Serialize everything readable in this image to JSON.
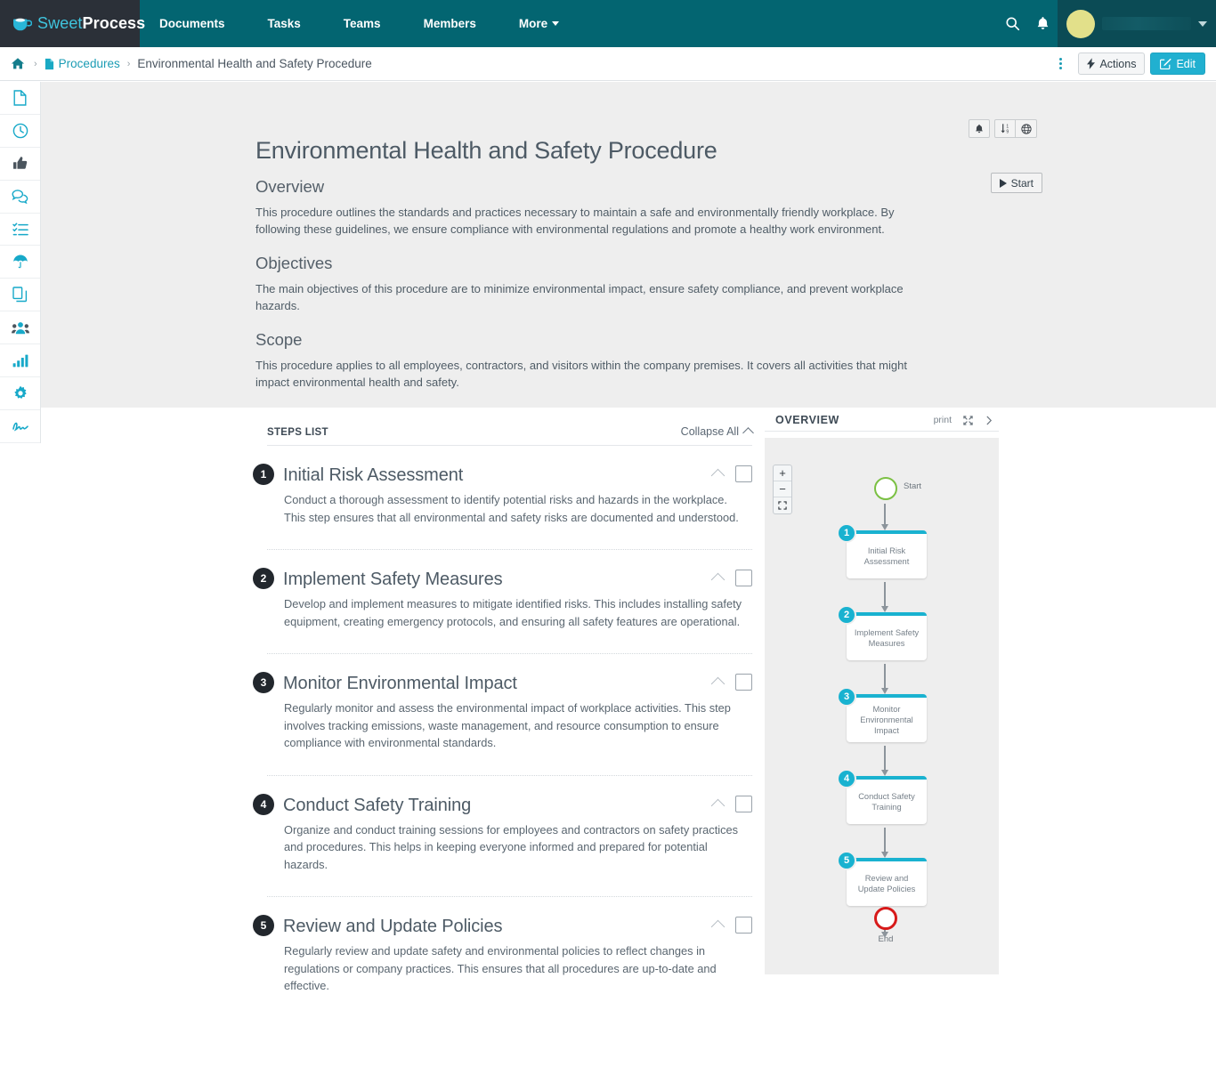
{
  "brand": {
    "name_light": "Sweet",
    "name_bold": "Process",
    "logo_icon": "coffee-cup-icon",
    "accent_cyan": "#19b2d0",
    "nav_teal": "#036571",
    "logo_dark": "#2b3038"
  },
  "topnav": {
    "items": [
      {
        "label": "Documents",
        "name": "nav-documents"
      },
      {
        "label": "Tasks",
        "name": "nav-tasks"
      },
      {
        "label": "Teams",
        "name": "nav-teams"
      },
      {
        "label": "Members",
        "name": "nav-members"
      },
      {
        "label": "More",
        "name": "nav-more",
        "has_caret": true
      }
    ],
    "search_icon": "search-icon",
    "bell_icon": "bell-icon",
    "avatar_color": "#e2e08a"
  },
  "breadcrumb": {
    "home_icon": "home-icon",
    "doc_icon": "document-icon",
    "separator": "›",
    "link": "Procedures",
    "current": "Environmental Health and Safety Procedure",
    "kebab_icon": "kebab-menu-icon",
    "actions_label": "Actions",
    "actions_icon": "lightning-bolt-icon",
    "edit_label": "Edit",
    "edit_icon": "pencil-square-icon"
  },
  "rail": {
    "items": [
      {
        "icon": "document-icon",
        "name": "rail-documents"
      },
      {
        "icon": "clock-icon",
        "name": "rail-recent"
      },
      {
        "icon": "thumbs-up-icon",
        "name": "rail-approvals"
      },
      {
        "icon": "chat-bubbles-icon",
        "name": "rail-comments"
      },
      {
        "icon": "checklist-icon",
        "name": "rail-tasks"
      },
      {
        "icon": "umbrella-icon",
        "name": "rail-policies"
      },
      {
        "icon": "copy-pages-icon",
        "name": "rail-duplicates"
      },
      {
        "icon": "users-group-icon",
        "name": "rail-teams"
      },
      {
        "icon": "bar-chart-icon",
        "name": "rail-reports"
      },
      {
        "icon": "gear-icon",
        "name": "rail-settings"
      },
      {
        "icon": "signature-icon",
        "name": "rail-signatures"
      }
    ]
  },
  "document": {
    "title": "Environmental Health and Safety Procedure",
    "sections": [
      {
        "heading": "Overview",
        "body": "This procedure outlines the standards and practices necessary to maintain a safe and environmentally friendly workplace. By following these guidelines, we ensure compliance with environmental regulations and promote a healthy work environment."
      },
      {
        "heading": "Objectives",
        "body": "The main objectives of this procedure are to minimize environmental impact, ensure safety compliance, and prevent workplace hazards."
      },
      {
        "heading": "Scope",
        "body": "This procedure applies to all employees, contractors, and visitors within the company premises. It covers all activities that might impact environmental health and safety."
      }
    ],
    "tools": [
      {
        "icon": "bell-icon",
        "name": "notify-button"
      },
      {
        "icon": "sort-numeric-icon",
        "name": "sort-button"
      },
      {
        "icon": "globe-icon",
        "name": "globe-button"
      }
    ],
    "start_label": "Start",
    "start_icon": "play-icon"
  },
  "steps_panel": {
    "label": "STEPS LIST",
    "collapse_all": "Collapse All",
    "collapse_icon": "chevron-up-icon",
    "steps": [
      {
        "number": "1",
        "title": "Initial Risk Assessment",
        "description": "Conduct a thorough assessment to identify potential risks and hazards in the workplace. This step ensures that all environmental and safety risks are documented and understood."
      },
      {
        "number": "2",
        "title": "Implement Safety Measures",
        "description": "Develop and implement measures to mitigate identified risks. This includes installing safety equipment, creating emergency protocols, and ensuring all safety features are operational."
      },
      {
        "number": "3",
        "title": "Monitor Environmental Impact",
        "description": "Regularly monitor and assess the environmental impact of workplace activities. This step involves tracking emissions, waste management, and resource consumption to ensure compliance with environmental standards."
      },
      {
        "number": "4",
        "title": "Conduct Safety Training",
        "description": "Organize and conduct training sessions for employees and contractors on safety practices and procedures. This helps in keeping everyone informed and prepared for potential hazards."
      },
      {
        "number": "5",
        "title": "Review and Update Policies",
        "description": "Regularly review and update safety and environmental policies to reflect changes in regulations or company practices. This ensures that all procedures are up-to-date and effective."
      }
    ]
  },
  "overview_panel": {
    "title": "OVERVIEW",
    "print_label": "print",
    "expand_icon": "expand-arrows-icon",
    "collapse_icon": "chevron-right-icon",
    "zoom_in": "+",
    "zoom_out": "−",
    "fit_icon": "fit-screen-icon",
    "flowchart": {
      "start_label": "Start",
      "start_color": "#7bc043",
      "end_label": "End",
      "end_color": "#d71a1a",
      "node_accent": "#19b2d0",
      "nodes": [
        {
          "number": "1",
          "label": "Initial Risk Assessment"
        },
        {
          "number": "2",
          "label": "Implement Safety Measures"
        },
        {
          "number": "3",
          "label": "Monitor Environmental Impact"
        },
        {
          "number": "4",
          "label": "Conduct Safety Training"
        },
        {
          "number": "5",
          "label": "Review and Update Policies"
        }
      ]
    }
  }
}
